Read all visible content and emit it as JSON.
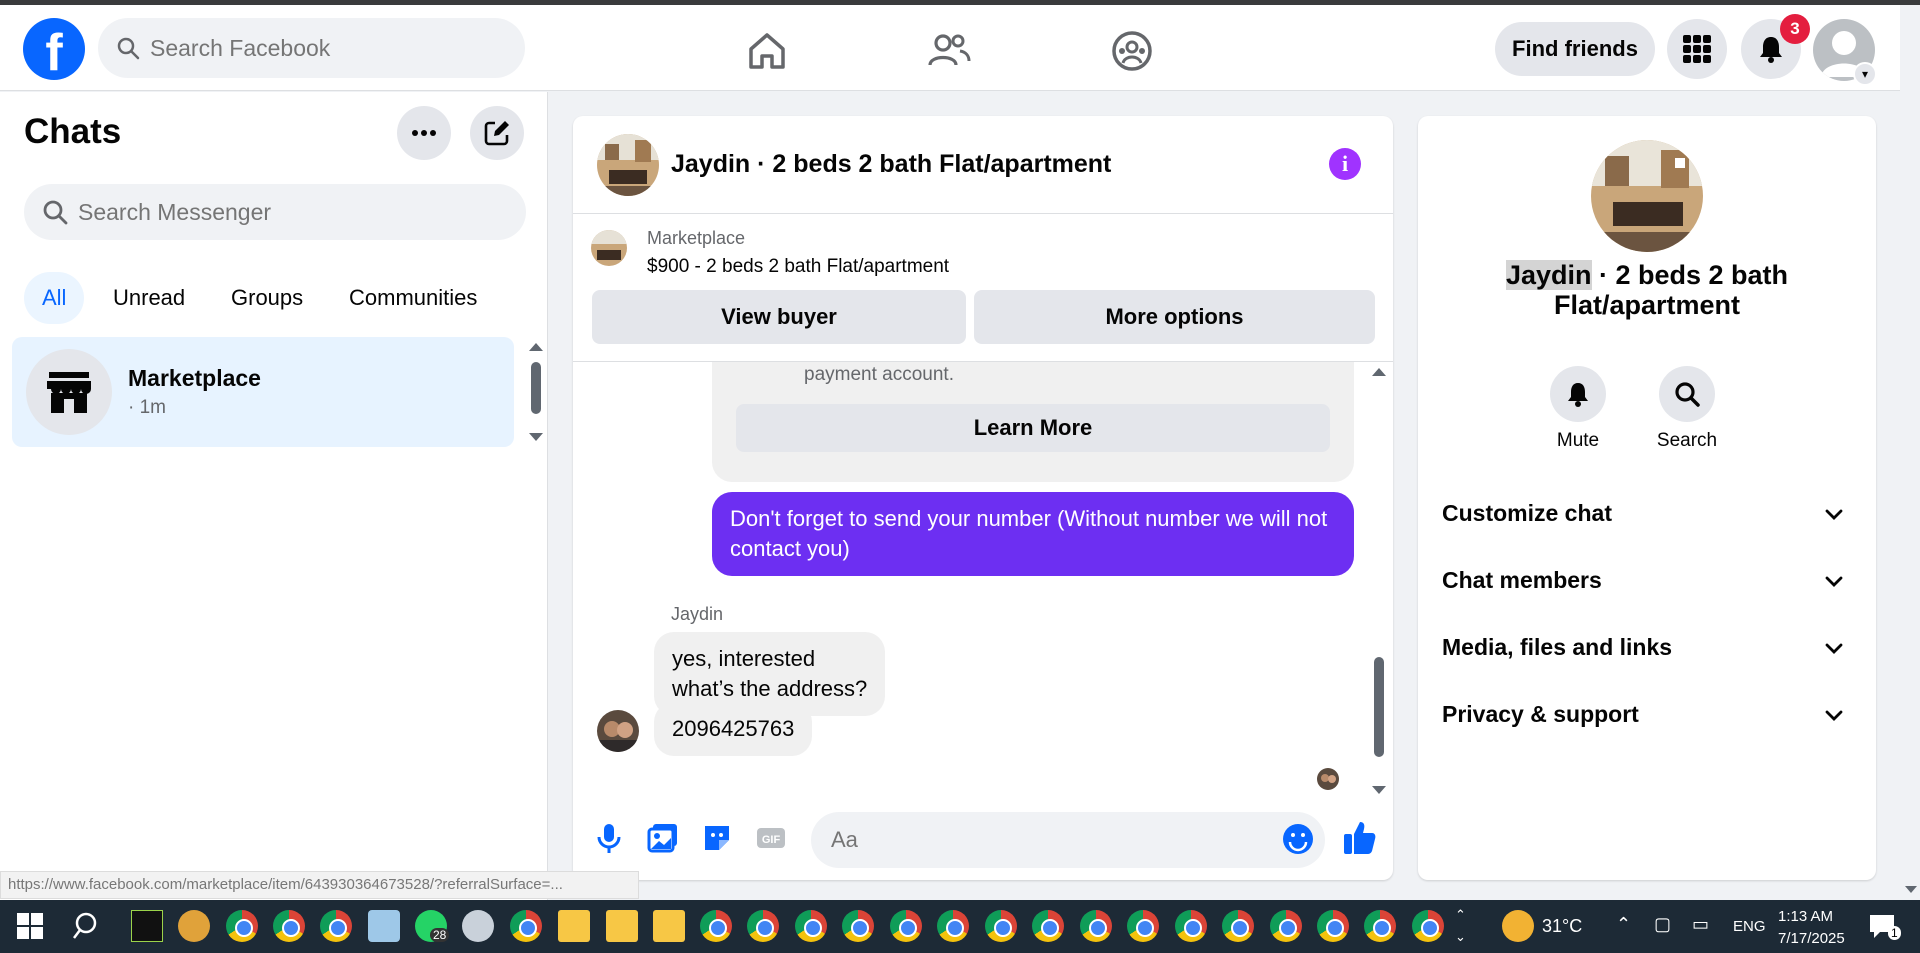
{
  "header": {
    "search_placeholder": "Search Facebook",
    "find_friends": "Find friends",
    "notification_count": "3",
    "brand_color": "#0866ff"
  },
  "left": {
    "title": "Chats",
    "search_placeholder": "Search Messenger",
    "filters": [
      "All",
      "Unread",
      "Groups",
      "Communities"
    ],
    "active_filter": "All",
    "chat": {
      "name": "Marketplace",
      "sub": "· 1m"
    }
  },
  "conversation": {
    "title": "Jaydin · 2 beds 2 bath Flat/apartment",
    "marketplace_label": "Marketplace",
    "listing": "$900 - 2 beds 2 bath Flat/apartment",
    "view_buyer": "View buyer",
    "more_options": "More options",
    "notice_text": "payment account.",
    "learn_more": "Learn More",
    "outgoing": "Don't forget to send your number (Without number we will not contact you)",
    "sender": "Jaydin",
    "incoming_1": "yes, interested\nwhat’s the address?",
    "incoming_2": "2096425763",
    "composer_placeholder": "Aa",
    "accent": "#6d2ff2"
  },
  "right": {
    "name_highlight": "Jaydin",
    "title_rest": " · 2 beds 2 bath Flat/apartment",
    "mute": "Mute",
    "search": "Search",
    "sections": [
      "Customize chat",
      "Chat members",
      "Media, files and links",
      "Privacy & support"
    ]
  },
  "status_url": "https://www.facebook.com/marketplace/item/643930364673528/?referralSurface=...",
  "taskbar": {
    "temperature": "31°C",
    "language": "ENG",
    "time": "1:13 AM",
    "date": "7/17/2025",
    "whatsapp_badge": "28",
    "notif_badge": "1"
  }
}
